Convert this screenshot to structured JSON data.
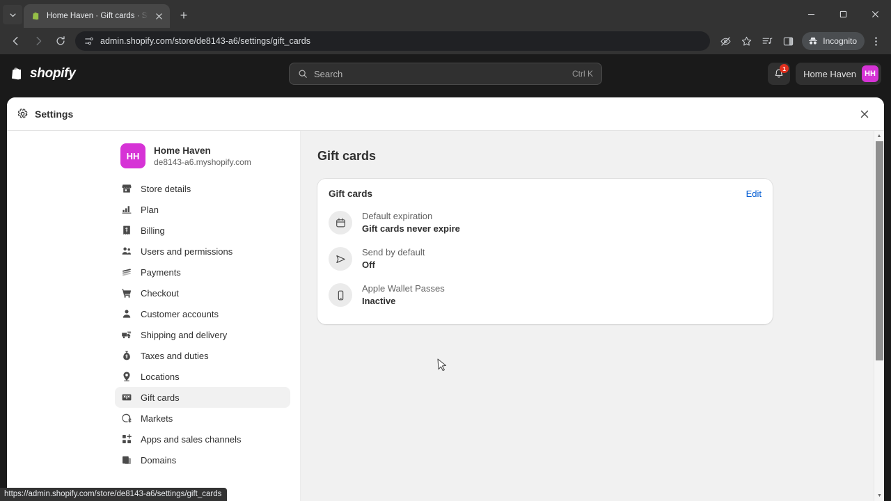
{
  "browser": {
    "tab": {
      "title": "Home Haven · Gift cards · Shop",
      "favicon_icon": "shopify-bag-icon",
      "close_icon": "close-icon"
    },
    "new_tab_label": "+",
    "tab_list_icon": "chevron-down-icon",
    "window": {
      "minimize_label": "—",
      "maximize_label": "▢",
      "close_label": "✕"
    },
    "toolbar": {
      "back_icon": "back-arrow-icon",
      "forward_icon": "forward-arrow-icon",
      "reload_icon": "reload-icon",
      "site_settings_icon": "site-settings-sliders-icon",
      "url": "admin.shopify.com/store/de8143-a6/settings/gift_cards",
      "tracking_protection_icon": "eye-slash-icon",
      "bookmark_icon": "star-icon",
      "reading_list_icon": "reading-list-icon",
      "side_panel_icon": "side-panel-icon",
      "incognito_label": "Incognito",
      "incognito_icon": "incognito-hat-icon",
      "menu_icon": "three-dot-menu-icon"
    },
    "status_url": "https://admin.shopify.com/store/de8143-a6/settings/gift_cards"
  },
  "shopify_header": {
    "logo_text": "shopify",
    "logo_icon": "shopify-bag-icon",
    "search": {
      "placeholder": "Search",
      "shortcut": "Ctrl K",
      "icon": "search-icon"
    },
    "notifications": {
      "icon": "bell-icon",
      "badge_count": "1",
      "badge_color": "#e0301e"
    },
    "store": {
      "name": "Home Haven",
      "initials": "HH",
      "avatar_color": "#d633d6"
    }
  },
  "modal": {
    "title": "Settings",
    "gear_icon": "gear-icon",
    "close_icon": "close-icon"
  },
  "sidebar": {
    "store": {
      "initials": "HH",
      "name": "Home Haven",
      "domain": "de8143-a6.myshopify.com"
    },
    "items": [
      {
        "label": "Store details",
        "icon": "storefront-icon",
        "active": false
      },
      {
        "label": "Plan",
        "icon": "chart-bar-icon",
        "active": false
      },
      {
        "label": "Billing",
        "icon": "billing-receipt-icon",
        "active": false
      },
      {
        "label": "Users and permissions",
        "icon": "users-icon",
        "active": false
      },
      {
        "label": "Payments",
        "icon": "payments-card-icon",
        "active": false
      },
      {
        "label": "Checkout",
        "icon": "shopping-cart-icon",
        "active": false
      },
      {
        "label": "Customer accounts",
        "icon": "person-icon",
        "active": false
      },
      {
        "label": "Shipping and delivery",
        "icon": "delivery-truck-icon",
        "active": false
      },
      {
        "label": "Taxes and duties",
        "icon": "taxes-money-bag-icon",
        "active": false
      },
      {
        "label": "Locations",
        "icon": "location-pin-icon",
        "active": false
      },
      {
        "label": "Gift cards",
        "icon": "gift-card-icon",
        "active": true
      },
      {
        "label": "Markets",
        "icon": "globe-markets-icon",
        "active": false
      },
      {
        "label": "Apps and sales channels",
        "icon": "apps-grid-icon",
        "active": false
      },
      {
        "label": "Domains",
        "icon": "domains-icon",
        "active": false
      }
    ]
  },
  "main": {
    "page_title": "Gift cards",
    "card": {
      "title": "Gift cards",
      "edit_label": "Edit",
      "edit_color": "#005bd3",
      "rows": [
        {
          "icon": "calendar-expiration-icon",
          "label": "Default expiration",
          "value": "Gift cards never expire"
        },
        {
          "icon": "send-paper-plane-icon",
          "label": "Send by default",
          "value": "Off"
        },
        {
          "icon": "mobile-device-icon",
          "label": "Apple Wallet Passes",
          "value": "Inactive"
        }
      ]
    }
  },
  "scrollbar": {
    "up_arrow": "▲",
    "down_arrow": "▼"
  }
}
